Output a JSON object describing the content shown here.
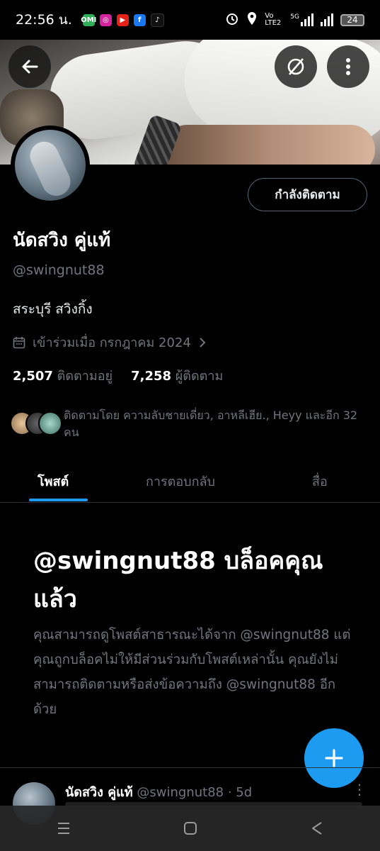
{
  "status_bar": {
    "time": "22:56 น.",
    "network": "Vo LTE2",
    "net_type": "5G",
    "battery": "24",
    "apps": [
      {
        "icon": "omi-app-icon",
        "label": "OMI",
        "color": "#2fae5a"
      },
      {
        "icon": "instagram-icon",
        "label": "◎",
        "color": "#d6249f"
      },
      {
        "icon": "youtube-icon",
        "label": "▶",
        "color": "#e62117"
      },
      {
        "icon": "facebook-icon",
        "label": "f",
        "color": "#1877f2"
      },
      {
        "icon": "tiktok-icon",
        "label": "♪",
        "color": "#111111"
      }
    ]
  },
  "profile": {
    "name": "นัดสวิง คู่แท้",
    "handle": "@swingnut88",
    "bio": "สระบุรี สวิงกิ้ง",
    "joined": "เข้าร่วมเมื่อ กรกฎาคม 2024",
    "following_count": "2,507",
    "following_label": "ติดตามอยู่",
    "followers_count": "7,258",
    "followers_label": "ผู้ติดตาม",
    "followed_by": "ติดตามโดย ความลับชายเดี่ยว, อาหลีเฮีย., Heyy และอีก 32 คน",
    "follow_button": "กำลังติดตาม"
  },
  "tabs": [
    {
      "label": "โพสต์",
      "active": true
    },
    {
      "label": "การตอบกลับ",
      "active": false
    },
    {
      "label": "สื่อ",
      "active": false
    }
  ],
  "blocked": {
    "title": "@swingnut88 บล็อคคุณแล้ว",
    "description": "คุณสามารถดูโพสต์สาธารณะได้จาก @swingnut88 แต่คุณถูกบล็อคไม่ให้มีส่วนร่วมกับโพสต์เหล่านั้น คุณยังไม่สามารถติดตามหรือส่งข้อความถึง @swingnut88 อีกด้วย"
  },
  "post_preview": {
    "name": "นัดสวิง คู่แท้",
    "handle": "@swingnut88",
    "time": "· 5d"
  },
  "colors": {
    "accent": "#1d9bf0",
    "muted": "#71767b",
    "background": "#000000"
  }
}
